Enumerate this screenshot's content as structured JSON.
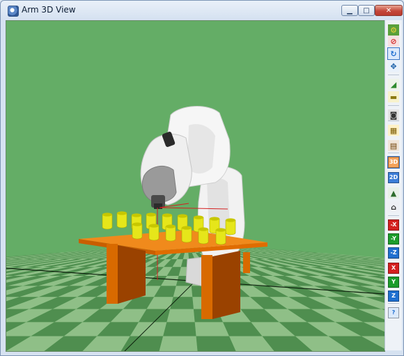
{
  "window": {
    "title": "Arm 3D View"
  },
  "titlebar_buttons": {
    "minimize": "▁",
    "maximize": "□",
    "close": "✕"
  },
  "colors": {
    "sky": "#64ad66",
    "floor_light": "#8fbf87",
    "floor_dark": "#4f8e4f",
    "table": "#f07800",
    "cups": "#e6e61a",
    "robot": "#eeeeee",
    "axis_red": "#d42020",
    "axis_green": "#1c9c2c",
    "axis_blue": "#1f6fd0"
  },
  "toolbar": {
    "items": [
      {
        "name": "robot-settings-icon",
        "label": "",
        "bg": "#5aa03c",
        "fg": "#f2d33a"
      },
      {
        "name": "hide-robot-icon",
        "label": "",
        "bg": "#f7e1e1",
        "fg": "#d32f2f"
      },
      {
        "name": "rotate-view-icon",
        "label": "",
        "bg": "#dbe9fb",
        "fg": "#1f6fd0",
        "selected": true
      },
      {
        "name": "move-view-icon",
        "label": "",
        "bg": "#e9f1fb",
        "fg": "#1a5fa8"
      },
      {
        "name": "zoom-fit-icon",
        "label": "",
        "bg": "#eef3ea",
        "fg": "#2f8a2f"
      },
      {
        "name": "ruler-icon",
        "label": "",
        "bg": "#f7f2cc",
        "fg": "#8c7a10"
      },
      {
        "name": "camera-icon",
        "label": "",
        "bg": "#e4e4e4",
        "fg": "#333333"
      },
      {
        "name": "film-edit-icon",
        "label": "",
        "bg": "#fff2c8",
        "fg": "#7a5a00"
      },
      {
        "name": "film-icon",
        "label": "",
        "bg": "#f0e4d8",
        "fg": "#6a3c00"
      },
      {
        "name": "view-3d-icon",
        "label": "3D",
        "bg": "#f5a25a",
        "fg": "#ffffff",
        "selected": true
      },
      {
        "name": "view-2d-icon",
        "label": "2D",
        "bg": "#3b7dd8",
        "fg": "#ffffff"
      },
      {
        "name": "fit-view-icon",
        "label": "",
        "bg": "#e8f0e8",
        "fg": "#2d6c2d"
      },
      {
        "name": "home-view-icon",
        "label": "",
        "bg": "#eef0f5",
        "fg": "#333333"
      },
      {
        "name": "view-minus-x-icon",
        "label": "-X",
        "bg": "#d42020",
        "fg": "#ffffff"
      },
      {
        "name": "view-minus-y-icon",
        "label": "-Y",
        "bg": "#1c9c2c",
        "fg": "#ffffff"
      },
      {
        "name": "view-minus-z-icon",
        "label": "-Z",
        "bg": "#1f6fd0",
        "fg": "#ffffff"
      },
      {
        "name": "view-x-icon",
        "label": "X",
        "bg": "#d42020",
        "fg": "#ffffff"
      },
      {
        "name": "view-y-icon",
        "label": "Y",
        "bg": "#1c9c2c",
        "fg": "#ffffff"
      },
      {
        "name": "view-z-icon",
        "label": "Z",
        "bg": "#1f6fd0",
        "fg": "#ffffff"
      },
      {
        "name": "help-icon",
        "label": "?",
        "bg": "#dbe9fb",
        "fg": "#1f6fd0"
      }
    ]
  }
}
